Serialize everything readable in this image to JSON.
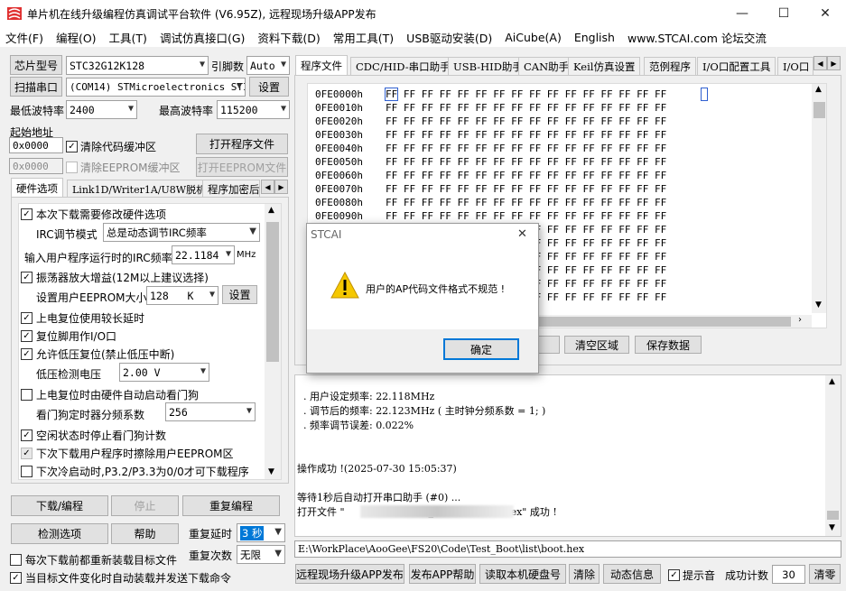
{
  "window": {
    "title": "单片机在线升级编程仿真调试平台软件 (V6.95Z), 远程现场升级APP发布",
    "minimize": "—",
    "maximize": "☐",
    "close": "✕"
  },
  "menu": [
    "文件(F)",
    "编程(O)",
    "工具(T)",
    "调试仿真接口(G)",
    "资料下载(D)",
    "常用工具(T)",
    "USB驱动安装(D)",
    "AiCube(A)",
    "English",
    "www.STCAI.com 论坛交流"
  ],
  "left": {
    "chip_model_btn": "芯片型号",
    "chip_model_value": "STC32G12K128",
    "pin_count_label": "引脚数",
    "pin_count_value": "Auto",
    "scan_port_btn": "扫描串口",
    "port_value": "(COM14) STMicroelectronics STI",
    "settings_btn": "设置",
    "min_baud_label": "最低波特率",
    "min_baud_value": "2400",
    "max_baud_label": "最高波特率",
    "max_baud_value": "115200",
    "start_addr_label": "起始地址",
    "code_addr_value": "0x0000",
    "clear_code_buf": "清除代码缓冲区",
    "open_program_btn": "打开程序文件",
    "eeprom_addr_value": "0x0000",
    "clear_eeprom_buf": "清除EEPROM缓冲区",
    "open_eeprom_btn": "打开EEPROM文件",
    "tabs": [
      "硬件选项",
      "Link1D/Writer1A/U8W脱机",
      "程序加密后"
    ],
    "options": {
      "modify_hw": "本次下载需要修改硬件选项",
      "irc_mode_label": "IRC调节模式",
      "irc_mode_value": "总是动态调节IRC频率",
      "irc_freq_label": "输入用户程序运行时的IRC频率",
      "irc_freq_value": "22.1184",
      "irc_freq_unit": "MHz",
      "osc_gain": "振荡器放大增益(12M以上建议选择)",
      "eeprom_size_label": "设置用户EEPROM大小",
      "eeprom_size_value": "128   K",
      "eeprom_set_btn": "设置",
      "power_reset": "上电复位使用较长延时",
      "reset_io": "复位脚用作I/O口",
      "lvd_reset": "允许低压复位(禁止低压中断)",
      "lvd_label": "低压检测电压",
      "lvd_value": "2.00 V",
      "wdt_auto": "上电复位时由硬件自动启动看门狗",
      "wdt_div_label": "看门狗定时器分频系数",
      "wdt_div_value": "256",
      "idle_wdt": "空闲状态时停止看门狗计数",
      "erase_eeprom": "下次下载用户程序时擦除用户EEPROM区",
      "p32_p33": "下次冷启动时,P3.2/P3.3为0/0才可下载程序"
    },
    "download_btn": "下载/编程",
    "stop_btn": "停止",
    "reprogram_btn": "重复编程",
    "check_btn": "检测选项",
    "help_btn": "帮助",
    "repeat_delay_label": "重复延时",
    "repeat_delay_value": "3 秒",
    "repeat_count_label": "重复次数",
    "repeat_count_value": "无限",
    "reload_each": "每次下载前都重新装载目标文件",
    "auto_reload": "当目标文件变化时自动装载并发送下载命令"
  },
  "right": {
    "tabs": [
      "程序文件",
      "CDC/HID-串口助手",
      "USB-HID助手",
      "CAN助手",
      "Keil仿真设置",
      "范例程序",
      "I/O口配置工具",
      "I/O口"
    ],
    "hex_rows": [
      {
        "addr": "0FE0000h",
        "bytes": "FF FF FF FF FF FF FF FF FF FF FF FF FF FF FF FF"
      },
      {
        "addr": "0FE0010h",
        "bytes": "FF FF FF FF FF FF FF FF FF FF FF FF FF FF FF FF"
      },
      {
        "addr": "0FE0020h",
        "bytes": "FF FF FF FF FF FF FF FF FF FF FF FF FF FF FF FF"
      },
      {
        "addr": "0FE0030h",
        "bytes": "FF FF FF FF FF FF FF FF FF FF FF FF FF FF FF FF"
      },
      {
        "addr": "0FE0040h",
        "bytes": "FF FF FF FF FF FF FF FF FF FF FF FF FF FF FF FF"
      },
      {
        "addr": "0FE0050h",
        "bytes": "FF FF FF FF FF FF FF FF FF FF FF FF FF FF FF FF"
      },
      {
        "addr": "0FE0060h",
        "bytes": "FF FF FF FF FF FF FF FF FF FF FF FF FF FF FF FF"
      },
      {
        "addr": "0FE0070h",
        "bytes": "FF FF FF FF FF FF FF FF FF FF FF FF FF FF FF FF"
      },
      {
        "addr": "0FE0080h",
        "bytes": "FF FF FF FF FF FF FF FF FF FF FF FF FF FF FF FF"
      },
      {
        "addr": "0FE0090h",
        "bytes": "FF FF FF FF FF FF FF FF FF FF FF FF FF FF FF FF"
      },
      {
        "addr": "",
        "bytes": "FF FF FF FF FF FF FF FF FF FF FF FF FF FF FF FF"
      },
      {
        "addr": "",
        "bytes": "FF FF FF FF FF FF FF FF FF FF FF FF FF FF FF FF"
      },
      {
        "addr": "",
        "bytes": "FF FF FF FF FF FF FF FF FF FF FF FF FF FF FF FF"
      },
      {
        "addr": "",
        "bytes": "FF FF FF FF FF FF FF FF FF FF FF FF FF FF FF FF"
      },
      {
        "addr": "",
        "bytes": "FF FF FF FF FF FF FF FF FF FF FF FF FF FF FF FF"
      },
      {
        "addr": "",
        "bytes": "FF FF FF FF FF FF FF FF FF FF FF FF FF FF FF FF"
      }
    ],
    "btn_partial": "充",
    "btn_clear_buf": "清空区域",
    "btn_save_data": "保存数据",
    "log": [
      "  . 用户设定频率: 22.118MHz",
      "  . 调节后的频率: 22.123MHz ( 主时钟分频系数 = 1; )",
      "  . 频率调节误差: 0.022%",
      "",
      "",
      "操作成功 !(2025-07-30 15:05:37)",
      "",
      "等待1秒后自动打开串口助手 (#0) ...",
      "打开文件 \"                    Test_Boot\\list\\boot.hex\" 成功 !"
    ],
    "file_path": "E:\\WorkPlace\\AooGee\\FS20\\Code\\Test_Boot\\list\\boot.hex",
    "bottom_btns": [
      "远程现场升级APP发布",
      "发布APP帮助",
      "读取本机硬盘号",
      "清除",
      "动态信息"
    ],
    "sound_label": "提示音",
    "success_label": "成功计数",
    "success_count": "30",
    "clear_count_btn": "清零"
  },
  "dialog": {
    "title": "STCAI",
    "message": "用户的AP代码文件格式不规范 !",
    "ok": "确定"
  }
}
